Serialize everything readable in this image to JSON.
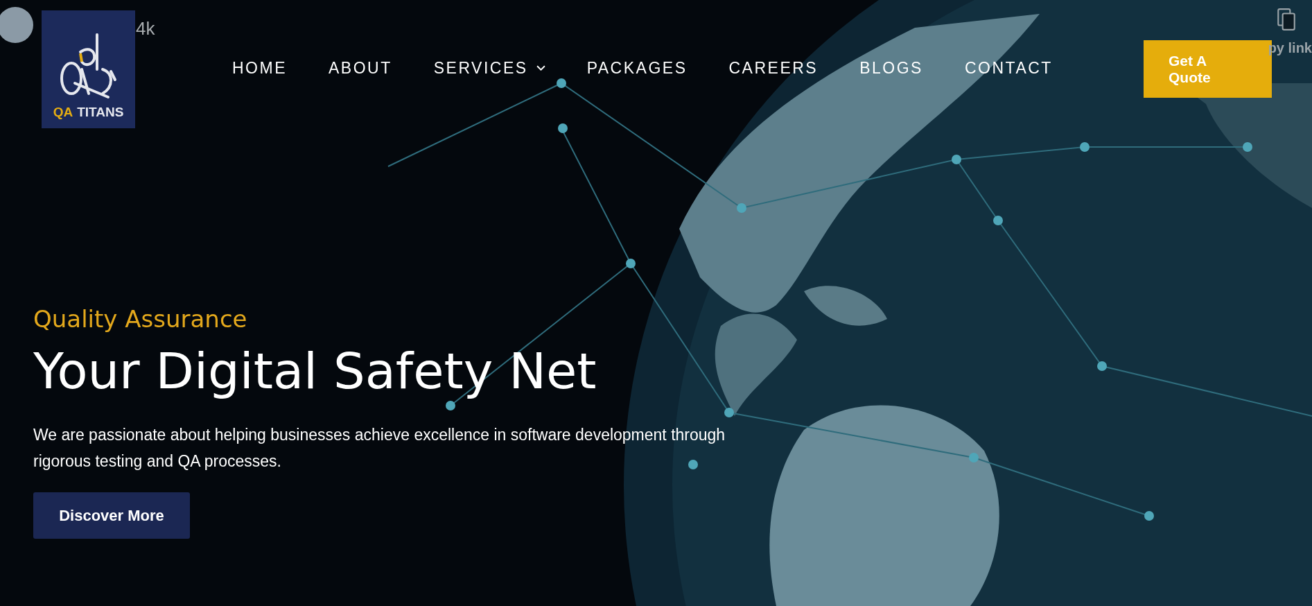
{
  "video_overlay": {
    "title": "4k",
    "share_label": "py link"
  },
  "logo": {
    "mark": "QA",
    "word": "TITANS"
  },
  "nav": {
    "items": [
      {
        "label": "HOME",
        "has_dropdown": false
      },
      {
        "label": "ABOUT",
        "has_dropdown": false
      },
      {
        "label": "SERVICES",
        "has_dropdown": true
      },
      {
        "label": "PACKAGES",
        "has_dropdown": false
      },
      {
        "label": "CAREERS",
        "has_dropdown": false
      },
      {
        "label": "BLOGS",
        "has_dropdown": false
      },
      {
        "label": "CONTACT",
        "has_dropdown": false
      }
    ]
  },
  "quote_button": "Get A Quote",
  "hero": {
    "eyebrow": "Quality Assurance",
    "headline": "Your Digital Safety Net",
    "description": "We are passionate about helping businesses achieve excellence in software development through rigorous testing and QA processes.",
    "button": "Discover More"
  }
}
